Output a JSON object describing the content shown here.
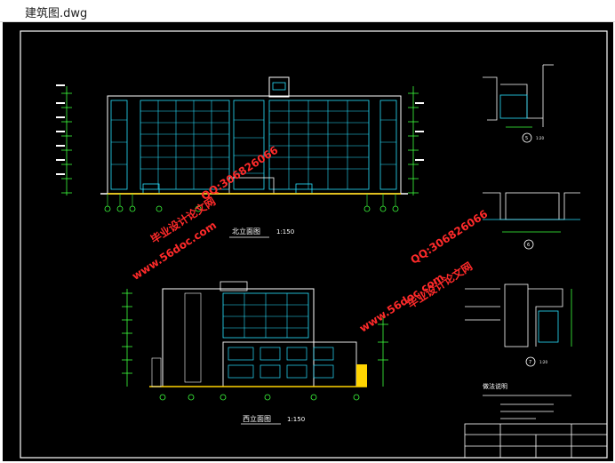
{
  "window": {
    "title": "建筑图.dwg"
  },
  "drawing": {
    "front_elevation": {
      "title": "北立面图",
      "scale": "1:150"
    },
    "west_elevation": {
      "title": "西立面图",
      "scale": "1:150"
    },
    "detail_labels": {
      "d1": "5",
      "d2": "6",
      "d3": "7",
      "scale_a": "1:20",
      "scale_b": "1:20"
    },
    "notes": {
      "heading": "做法说明"
    }
  },
  "watermarks": {
    "site": "www.56doc.com",
    "brand": "毕业设计论文网",
    "qq": "QQ:306826066"
  },
  "colors": {
    "background": "#000000",
    "window_cyan": "#29e0ff",
    "line_white": "#ffffff",
    "accent_yellow": "#ffd400",
    "accent_green": "#3cff3c",
    "watermark": "#ff2a2a"
  }
}
